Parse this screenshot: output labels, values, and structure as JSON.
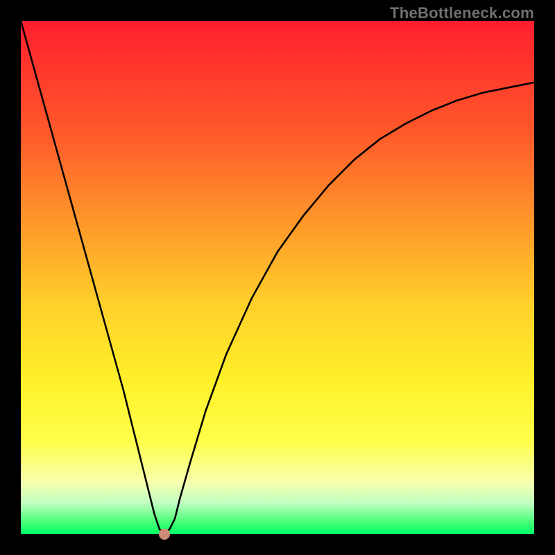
{
  "source_label": "TheBottleneck.com",
  "colors": {
    "frame": "#000000",
    "dot": "#cf8a78",
    "curve": "#000000",
    "gradient_top": "#ff1e2e",
    "gradient_bottom": "#00ff66"
  },
  "chart_data": {
    "type": "line",
    "title": "",
    "xlabel": "",
    "ylabel": "",
    "xlim": [
      0,
      100
    ],
    "ylim": [
      0,
      100
    ],
    "grid": false,
    "legend": false,
    "series": [
      {
        "name": "bottleneck-curve",
        "x": [
          0,
          5,
          10,
          15,
          20,
          24,
          26,
          27,
          28,
          29,
          30,
          31,
          33,
          36,
          40,
          45,
          50,
          55,
          60,
          65,
          70,
          75,
          80,
          85,
          90,
          95,
          100
        ],
        "y": [
          100,
          82,
          64,
          46,
          28,
          12,
          4,
          1,
          0,
          1,
          3,
          7,
          14,
          24,
          35,
          46,
          55,
          62,
          68,
          73,
          77,
          80,
          82.5,
          84.5,
          86,
          87,
          88
        ]
      }
    ],
    "marker": {
      "x": 28,
      "y": 0
    }
  }
}
